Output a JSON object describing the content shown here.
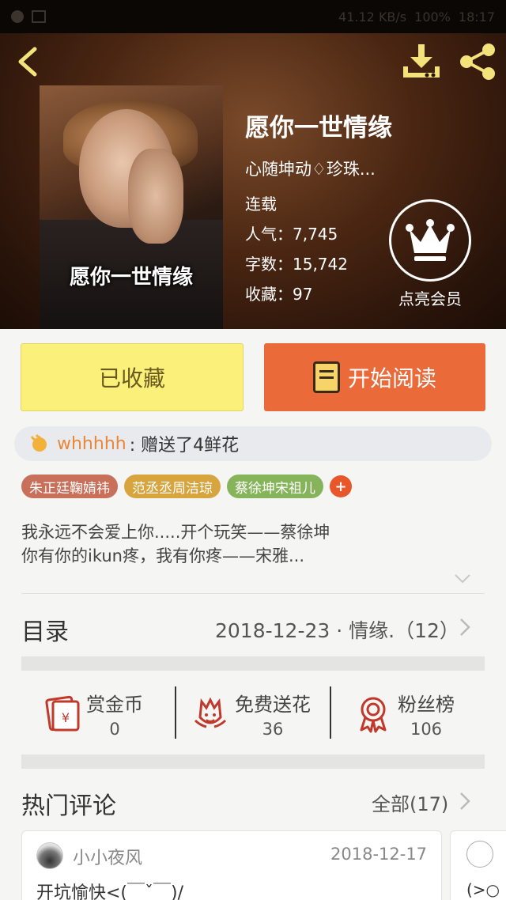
{
  "status_bar": {
    "speed": "41.12 KB/s",
    "battery": "100%",
    "time": "18:17"
  },
  "header": {
    "cover_title": "愿你一世情缘",
    "title": "愿你一世情缘",
    "author": "心随坤动♢珍珠...",
    "status": "连载",
    "popularity": "人气：7,745",
    "word_count": "字数：15,742",
    "favorites": "收藏：97",
    "vip_label": "点亮会员"
  },
  "actions": {
    "collected_label": "已收藏",
    "read_label": "开始阅读"
  },
  "gift": {
    "user": "whhhhh",
    "text": ": 赠送了4鲜花"
  },
  "tags": [
    {
      "label": "朱正廷鞠婧祎",
      "color": "#c9705a"
    },
    {
      "label": "范丞丞周洁琼",
      "color": "#d8a43e"
    },
    {
      "label": "蔡徐坤宋祖儿",
      "color": "#86b45a"
    }
  ],
  "tag_add": "+",
  "intro": {
    "line1": "我永远不会爱上你.....开个玩笑——蔡徐坤",
    "line2": "你有你的ikun疼，我有你疼——宋雅..."
  },
  "toc": {
    "title": "目录",
    "latest": "2018-12-23 · 情缘.（12）"
  },
  "stats": [
    {
      "label": "赏金币",
      "value": "0",
      "icon": "red-envelope-icon"
    },
    {
      "label": "免费送花",
      "value": "36",
      "icon": "flower-icon"
    },
    {
      "label": "粉丝榜",
      "value": "106",
      "icon": "ribbon-badge-icon"
    }
  ],
  "comments_section": {
    "title": "热门评论",
    "all_label": "全部(17)"
  },
  "comments": [
    {
      "user": "小小夜风",
      "date": "2018-12-17",
      "text": "开坑愉快<(￣ˇ￣)/"
    },
    {
      "text": "(>○"
    }
  ],
  "colors": {
    "accent_orange": "#ea6a3a",
    "collected_yellow": "#fbf07a",
    "gift_user": "#e8873a",
    "icon_gold": "#f4e27a",
    "icon_red": "#c0392b"
  }
}
